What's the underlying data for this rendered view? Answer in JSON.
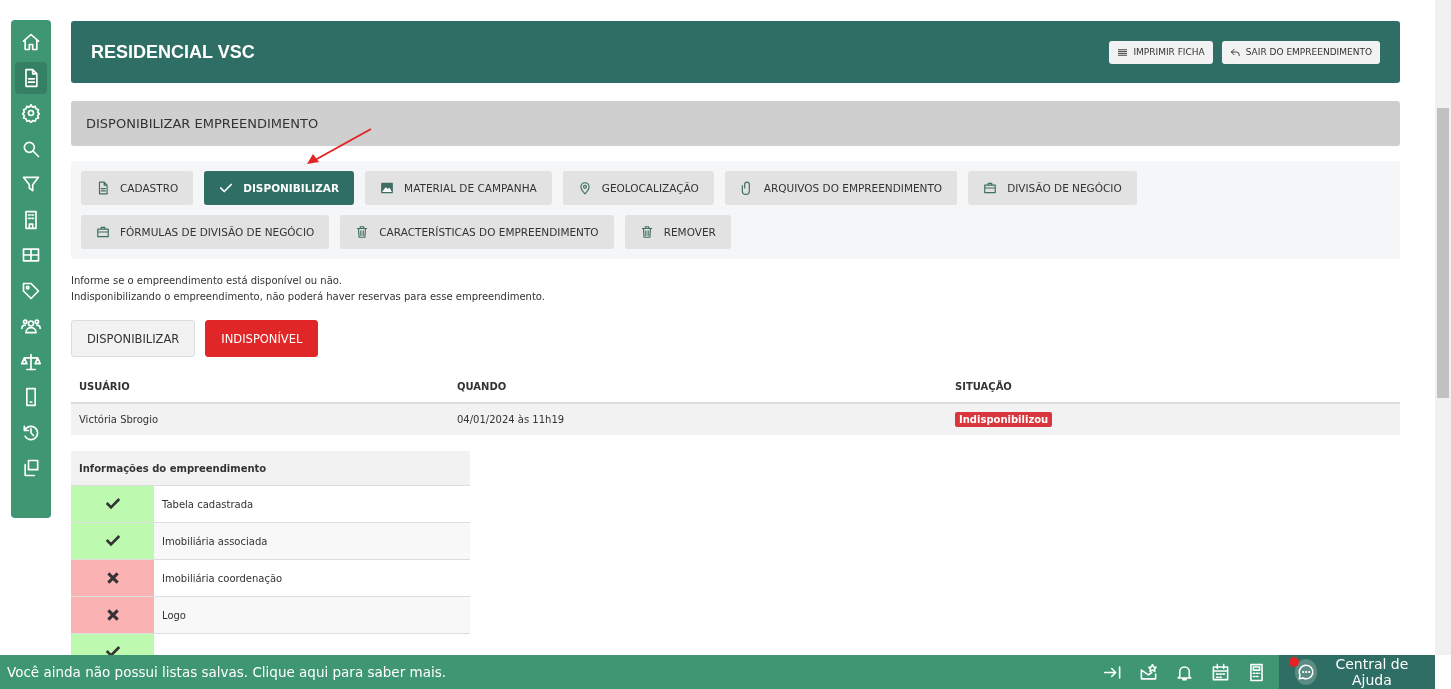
{
  "sidebar": {
    "items": [
      {
        "kind": "home",
        "selected": false
      },
      {
        "kind": "document",
        "selected": true
      },
      {
        "kind": "gear",
        "selected": false
      },
      {
        "kind": "search",
        "selected": false
      },
      {
        "kind": "filter",
        "selected": false
      },
      {
        "kind": "building",
        "selected": false
      },
      {
        "kind": "table",
        "selected": false
      },
      {
        "kind": "tag",
        "selected": false
      },
      {
        "kind": "people",
        "selected": false
      },
      {
        "kind": "scale",
        "selected": false
      },
      {
        "kind": "phone",
        "selected": false
      },
      {
        "kind": "history",
        "selected": false
      },
      {
        "kind": "copy",
        "selected": false
      }
    ]
  },
  "header": {
    "title": "RESIDENCIAL VSC",
    "buttons": [
      {
        "kind": "list",
        "label": "IMPRIMIR FICHA"
      },
      {
        "kind": "back",
        "label": "SAIR DO EMPREENDIMENTO"
      }
    ]
  },
  "section_title": "DISPONIBILIZAR EMPREENDIMENTO",
  "tabs": [
    {
      "kind": "document",
      "label": "CADASTRO",
      "selected": false
    },
    {
      "kind": "check",
      "label": "DISPONIBILIZAR",
      "selected": true
    },
    {
      "kind": "image",
      "label": "MATERIAL DE CAMPANHA",
      "selected": false
    },
    {
      "kind": "pin",
      "label": "GEOLOCALIZAÇÃO",
      "selected": false
    },
    {
      "kind": "clip",
      "label": "ARQUIVOS DO EMPREENDIMENTO",
      "selected": false
    },
    {
      "kind": "briefcase",
      "label": "DIVISÃO DE NEGÓCIO",
      "selected": false
    },
    {
      "kind": "briefcase",
      "label": "FÓRMULAS DE DIVISÃO DE NEGÓCIO",
      "selected": false
    },
    {
      "kind": "trash",
      "label": "CARACTERÍSTICAS DO EMPREENDIMENTO",
      "selected": false
    },
    {
      "kind": "trash",
      "label": "REMOVER",
      "selected": false
    }
  ],
  "description": [
    "Informe se o empreendimento está disponível ou não.",
    "Indisponibilizando o empreendimento, não poderá haver reservas para esse empreendimento."
  ],
  "availability": [
    {
      "label": "DISPONIBILIZAR",
      "selected": false
    },
    {
      "label": "INDISPONÍVEL",
      "selected": true
    }
  ],
  "history": {
    "columns": [
      "USUÁRIO",
      "QUANDO",
      "SITUAÇÃO"
    ],
    "rows": [
      {
        "user": "Victória Sbrogio",
        "when": "04/01/2024 às 11h19",
        "status": "Indisponibilizou",
        "color": "#d9363e"
      }
    ]
  },
  "checklist": {
    "title": "Informações do empreendimento",
    "rows": [
      {
        "ok": true,
        "label": "Tabela cadastrada"
      },
      {
        "ok": true,
        "label": "Imobiliária associada"
      },
      {
        "ok": false,
        "label": "Imobiliária coordenação"
      },
      {
        "ok": false,
        "label": "Logo"
      },
      {
        "ok": true
      }
    ]
  },
  "footer": {
    "message": "Você ainda não possui listas salvas. Clique aqui para saber mais.",
    "help": "Central de Ajuda",
    "help_alert": true
  }
}
